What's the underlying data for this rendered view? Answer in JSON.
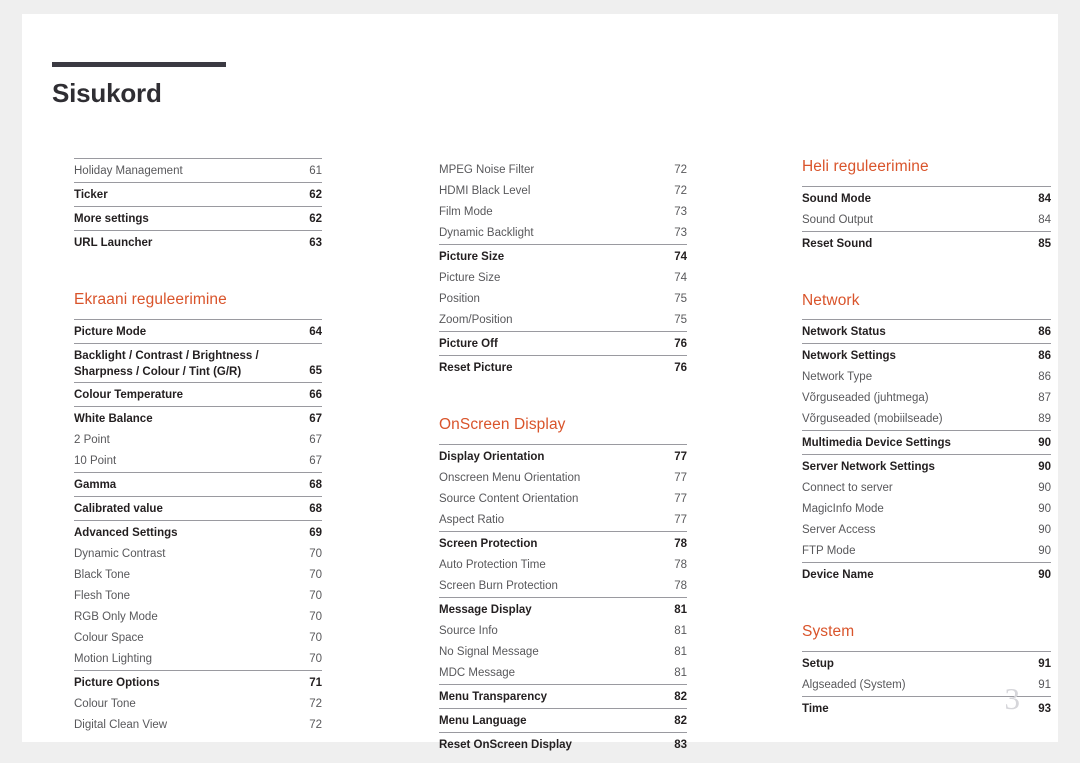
{
  "document": {
    "title": "Sisukord",
    "folio": "3",
    "accent_color": "#d9542b",
    "title_rule_color": "#3b3a42",
    "rule_color": "#9a9aa0"
  },
  "columns": [
    {
      "id": "column-1",
      "blocks": [
        {
          "type": "group",
          "entries": [
            {
              "label": "Holiday Management",
              "page": "61",
              "level": "minor"
            }
          ]
        },
        {
          "type": "group",
          "entries": [
            {
              "label": "Ticker",
              "page": "62",
              "level": "major"
            }
          ]
        },
        {
          "type": "group",
          "entries": [
            {
              "label": "More settings",
              "page": "62",
              "level": "major"
            }
          ]
        },
        {
          "type": "group",
          "entries": [
            {
              "label": "URL Launcher",
              "page": "63",
              "level": "major"
            }
          ]
        },
        {
          "type": "heading",
          "label": "Ekraani reguleerimine",
          "spaced": true
        },
        {
          "type": "group",
          "entries": [
            {
              "label": "Picture Mode",
              "page": "64",
              "level": "major"
            }
          ]
        },
        {
          "type": "group",
          "entries": [
            {
              "label": "Backlight / Contrast / Brightness / Sharpness / Colour / Tint (G/R)",
              "page": "65",
              "level": "major",
              "wrap": true
            }
          ]
        },
        {
          "type": "group",
          "entries": [
            {
              "label": "Colour Temperature",
              "page": "66",
              "level": "major"
            }
          ]
        },
        {
          "type": "group",
          "entries": [
            {
              "label": "White Balance",
              "page": "67",
              "level": "major"
            },
            {
              "label": "2 Point",
              "page": "67",
              "level": "minor"
            },
            {
              "label": "10 Point",
              "page": "67",
              "level": "minor"
            }
          ]
        },
        {
          "type": "group",
          "entries": [
            {
              "label": "Gamma",
              "page": "68",
              "level": "major"
            }
          ]
        },
        {
          "type": "group",
          "entries": [
            {
              "label": "Calibrated value",
              "page": "68",
              "level": "major"
            }
          ]
        },
        {
          "type": "group",
          "entries": [
            {
              "label": "Advanced Settings",
              "page": "69",
              "level": "major"
            },
            {
              "label": "Dynamic Contrast",
              "page": "70",
              "level": "minor"
            },
            {
              "label": "Black Tone",
              "page": "70",
              "level": "minor"
            },
            {
              "label": "Flesh Tone",
              "page": "70",
              "level": "minor"
            },
            {
              "label": "RGB Only Mode",
              "page": "70",
              "level": "minor"
            },
            {
              "label": "Colour Space",
              "page": "70",
              "level": "minor"
            },
            {
              "label": "Motion Lighting",
              "page": "70",
              "level": "minor"
            }
          ]
        },
        {
          "type": "group",
          "entries": [
            {
              "label": "Picture Options",
              "page": "71",
              "level": "major"
            },
            {
              "label": "Colour Tone",
              "page": "72",
              "level": "minor"
            },
            {
              "label": "Digital Clean View",
              "page": "72",
              "level": "minor"
            }
          ]
        }
      ]
    },
    {
      "id": "column-2",
      "blocks": [
        {
          "type": "group",
          "noRule": true,
          "entries": [
            {
              "label": "MPEG Noise Filter",
              "page": "72",
              "level": "minor"
            },
            {
              "label": "HDMI Black Level",
              "page": "72",
              "level": "minor"
            },
            {
              "label": "Film Mode",
              "page": "73",
              "level": "minor"
            },
            {
              "label": "Dynamic Backlight",
              "page": "73",
              "level": "minor"
            }
          ]
        },
        {
          "type": "group",
          "entries": [
            {
              "label": "Picture Size",
              "page": "74",
              "level": "major"
            },
            {
              "label": "Picture Size",
              "page": "74",
              "level": "minor"
            },
            {
              "label": "Position",
              "page": "75",
              "level": "minor"
            },
            {
              "label": "Zoom/Position",
              "page": "75",
              "level": "minor"
            }
          ]
        },
        {
          "type": "group",
          "entries": [
            {
              "label": "Picture Off",
              "page": "76",
              "level": "major"
            }
          ]
        },
        {
          "type": "group",
          "entries": [
            {
              "label": "Reset Picture",
              "page": "76",
              "level": "major"
            }
          ]
        },
        {
          "type": "heading",
          "label": "OnScreen Display",
          "spaced": true
        },
        {
          "type": "group",
          "entries": [
            {
              "label": "Display Orientation",
              "page": "77",
              "level": "major"
            },
            {
              "label": "Onscreen Menu Orientation",
              "page": "77",
              "level": "minor"
            },
            {
              "label": "Source Content Orientation",
              "page": "77",
              "level": "minor"
            },
            {
              "label": "Aspect Ratio",
              "page": "77",
              "level": "minor"
            }
          ]
        },
        {
          "type": "group",
          "entries": [
            {
              "label": "Screen Protection",
              "page": "78",
              "level": "major"
            },
            {
              "label": "Auto Protection Time",
              "page": "78",
              "level": "minor"
            },
            {
              "label": "Screen Burn Protection",
              "page": "78",
              "level": "minor"
            }
          ]
        },
        {
          "type": "group",
          "entries": [
            {
              "label": "Message Display",
              "page": "81",
              "level": "major"
            },
            {
              "label": "Source Info",
              "page": "81",
              "level": "minor"
            },
            {
              "label": "No Signal Message",
              "page": "81",
              "level": "minor"
            },
            {
              "label": "MDC Message",
              "page": "81",
              "level": "minor"
            }
          ]
        },
        {
          "type": "group",
          "entries": [
            {
              "label": "Menu Transparency",
              "page": "82",
              "level": "major"
            }
          ]
        },
        {
          "type": "group",
          "entries": [
            {
              "label": "Menu Language",
              "page": "82",
              "level": "major"
            }
          ]
        },
        {
          "type": "group",
          "entries": [
            {
              "label": "Reset OnScreen Display",
              "page": "83",
              "level": "major"
            }
          ]
        }
      ]
    },
    {
      "id": "column-3",
      "blocks": [
        {
          "type": "heading",
          "label": "Heli reguleerimine",
          "spaced": false
        },
        {
          "type": "group",
          "entries": [
            {
              "label": "Sound Mode",
              "page": "84",
              "level": "major"
            },
            {
              "label": "Sound Output",
              "page": "84",
              "level": "minor"
            }
          ]
        },
        {
          "type": "group",
          "entries": [
            {
              "label": "Reset Sound",
              "page": "85",
              "level": "major"
            }
          ]
        },
        {
          "type": "heading",
          "label": "Network",
          "spaced": true
        },
        {
          "type": "group",
          "entries": [
            {
              "label": "Network Status",
              "page": "86",
              "level": "major"
            }
          ]
        },
        {
          "type": "group",
          "entries": [
            {
              "label": "Network Settings",
              "page": "86",
              "level": "major"
            },
            {
              "label": "Network Type",
              "page": "86",
              "level": "minor"
            },
            {
              "label": "Võrguseaded (juhtmega)",
              "page": "87",
              "level": "minor"
            },
            {
              "label": "Võrguseaded (mobiilseade)",
              "page": "89",
              "level": "minor"
            }
          ]
        },
        {
          "type": "group",
          "entries": [
            {
              "label": "Multimedia Device Settings",
              "page": "90",
              "level": "major"
            }
          ]
        },
        {
          "type": "group",
          "entries": [
            {
              "label": "Server Network Settings",
              "page": "90",
              "level": "major"
            },
            {
              "label": "Connect to server",
              "page": "90",
              "level": "minor"
            },
            {
              "label": "MagicInfo Mode",
              "page": "90",
              "level": "minor"
            },
            {
              "label": "Server Access",
              "page": "90",
              "level": "minor"
            },
            {
              "label": "FTP Mode",
              "page": "90",
              "level": "minor"
            }
          ]
        },
        {
          "type": "group",
          "entries": [
            {
              "label": "Device Name",
              "page": "90",
              "level": "major"
            }
          ]
        },
        {
          "type": "heading",
          "label": "System",
          "spaced": true
        },
        {
          "type": "group",
          "entries": [
            {
              "label": "Setup",
              "page": "91",
              "level": "major"
            },
            {
              "label": "Algseaded (System)",
              "page": "91",
              "level": "minor"
            }
          ]
        },
        {
          "type": "group",
          "entries": [
            {
              "label": "Time",
              "page": "93",
              "level": "major"
            }
          ]
        }
      ]
    }
  ]
}
